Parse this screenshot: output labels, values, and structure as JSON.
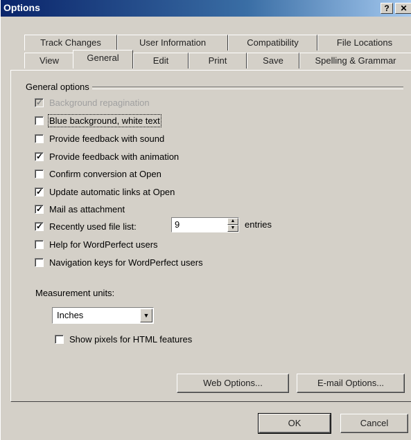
{
  "window": {
    "title": "Options"
  },
  "tabs_back": [
    "Track Changes",
    "User Information",
    "Compatibility",
    "File Locations"
  ],
  "tabs_front": [
    "View",
    "General",
    "Edit",
    "Print",
    "Save",
    "Spelling & Grammar"
  ],
  "active_tab": "General",
  "group": {
    "label": "General options"
  },
  "checkboxes": [
    {
      "label": "Background repagination",
      "checked": true,
      "disabled": true
    },
    {
      "label": "Blue background, white text",
      "checked": false,
      "disabled": false
    },
    {
      "label": "Provide feedback with sound",
      "checked": false,
      "disabled": false
    },
    {
      "label": "Provide feedback with animation",
      "checked": true,
      "disabled": false
    },
    {
      "label": "Confirm conversion at Open",
      "checked": false,
      "disabled": false
    },
    {
      "label": "Update automatic links at Open",
      "checked": true,
      "disabled": false
    },
    {
      "label": "Mail as attachment",
      "checked": true,
      "disabled": false
    },
    {
      "label": "Recently used file list:",
      "checked": true,
      "disabled": false
    },
    {
      "label": "Help for WordPerfect users",
      "checked": false,
      "disabled": false
    },
    {
      "label": "Navigation keys for WordPerfect users",
      "checked": false,
      "disabled": false
    }
  ],
  "recent_files": {
    "value": "9",
    "suffix": "entries"
  },
  "measurement": {
    "label": "Measurement units:",
    "value": "Inches"
  },
  "show_pixels": {
    "label": "Show pixels for HTML features",
    "checked": false
  },
  "buttons": {
    "web_options": "Web Options...",
    "email_options": "E-mail Options...",
    "ok": "OK",
    "cancel": "Cancel"
  }
}
